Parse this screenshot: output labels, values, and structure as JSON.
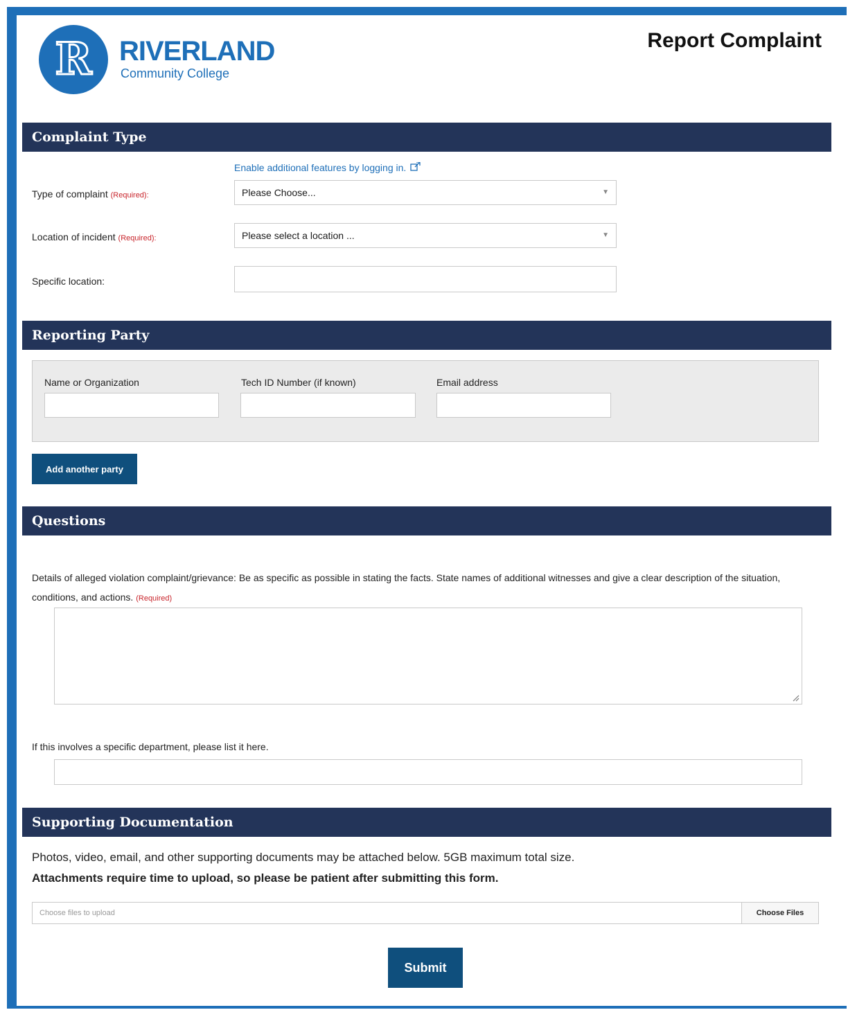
{
  "header": {
    "logo_letter": "R",
    "brand_name": "RIVERLAND",
    "brand_sub": "Community College",
    "page_title": "Report Complaint"
  },
  "colors": {
    "brand_blue": "#1e6fb8",
    "section_bar": "#233459",
    "button_dark": "#0f4f7d",
    "required_red": "#c8242b"
  },
  "complaint_type": {
    "heading": "Complaint Type",
    "login_link": "Enable additional features by logging in.",
    "login_icon": "external-link-icon",
    "type_label": "Type of complaint",
    "type_required": "(Required):",
    "type_value": "Please Choose...",
    "location_label": "Location of incident",
    "location_required": "(Required):",
    "location_value": "Please select a location ...",
    "specific_label": "Specific location:",
    "specific_value": ""
  },
  "reporting_party": {
    "heading": "Reporting Party",
    "name_label": "Name or Organization",
    "tech_id_label": "Tech ID Number (if known)",
    "email_label": "Email address",
    "add_button": "Add another party"
  },
  "questions": {
    "heading": "Questions",
    "details_label": "Details of alleged violation complaint/grievance: Be as specific as possible in stating the facts. State names of additional witnesses and give a clear description of the situation, conditions, and actions.",
    "details_required": "(Required)",
    "department_label": "If this involves a specific department, please list it here."
  },
  "supporting_docs": {
    "heading": "Supporting Documentation",
    "info_text": "Photos, video, email, and other supporting documents may be attached below. 5GB maximum total size.",
    "warning_text": "Attachments require time to upload, so please be patient after submitting this form.",
    "file_placeholder": "Choose files to upload",
    "file_button": "Choose Files"
  },
  "submit_label": "Submit"
}
